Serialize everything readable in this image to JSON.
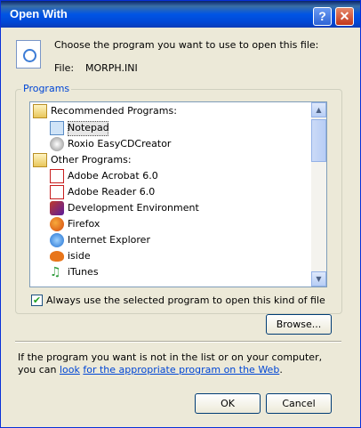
{
  "window": {
    "title": "Open With",
    "help_label": "?",
    "close_label": "✕"
  },
  "header": {
    "prompt": "Choose the program you want to use to open this file:",
    "file_label": "File:",
    "file_name": "MORPH.INI"
  },
  "programs": {
    "legend": "Programs",
    "recommended_label": "Recommended Programs:",
    "recommended": [
      {
        "name": "Notepad",
        "icon": "notepad-icon"
      },
      {
        "name": "Roxio EasyCDCreator",
        "icon": "roxio-icon"
      }
    ],
    "other_label": "Other Programs:",
    "other": [
      {
        "name": "Adobe Acrobat 6.0",
        "icon": "acrobat-icon"
      },
      {
        "name": "Adobe Reader 6.0",
        "icon": "reader-icon"
      },
      {
        "name": "Development Environment",
        "icon": "devenv-icon"
      },
      {
        "name": "Firefox",
        "icon": "firefox-icon"
      },
      {
        "name": "Internet Explorer",
        "icon": "ie-icon"
      },
      {
        "name": "iside",
        "icon": "iside-icon"
      },
      {
        "name": "iTunes",
        "icon": "itunes-icon"
      }
    ],
    "selected": "Notepad"
  },
  "always_use": {
    "label": "Always use the selected program to open this kind of file",
    "checked": true
  },
  "browse_label": "Browse...",
  "footer": {
    "text": "If the program you want is not in the list or on your computer, you can",
    "link_line1": "look",
    "link_line2": "for the appropriate program on the Web",
    "end": "."
  },
  "buttons": {
    "ok": "OK",
    "cancel": "Cancel"
  },
  "colors": {
    "title_bar": "#0055e5",
    "link": "#0046d5",
    "dialog_bg": "#ece9d8"
  }
}
